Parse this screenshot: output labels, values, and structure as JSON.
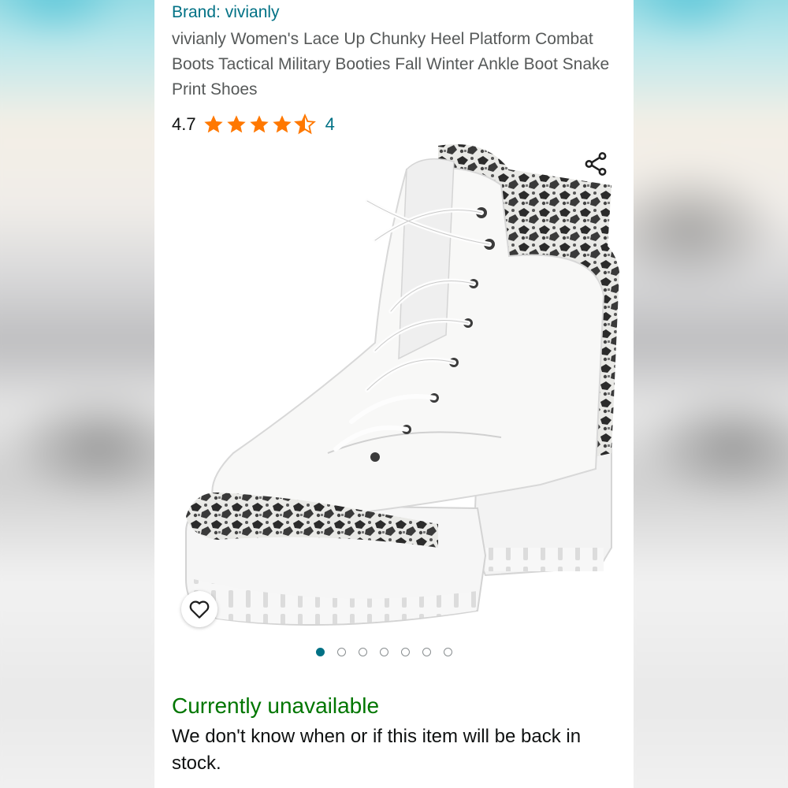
{
  "product": {
    "brand_line": "Brand: vivianly",
    "title": "vivianly Women's Lace Up Chunky Heel Platform Combat Boots Tactical Military Booties Fall Winter Ankle Boot Snake Print Shoes",
    "rating": "4.7",
    "rating_fraction": 0.94,
    "stars_filled": 4,
    "stars_half": 1,
    "rating_count": "4",
    "image_alt_icon": "snake-print-boot-image"
  },
  "gallery": {
    "dot_count": 7,
    "active_index": 0
  },
  "availability": {
    "status": "Currently unavailable",
    "message": "We don't know when or if this item will be back in stock."
  },
  "icons": {
    "share": "share-icon",
    "wishlist": "heart-icon"
  },
  "colors": {
    "link": "#007185",
    "star": "#ff7800",
    "unavailable": "#007600",
    "text": "#0f1111",
    "secondary_text": "#565959"
  }
}
